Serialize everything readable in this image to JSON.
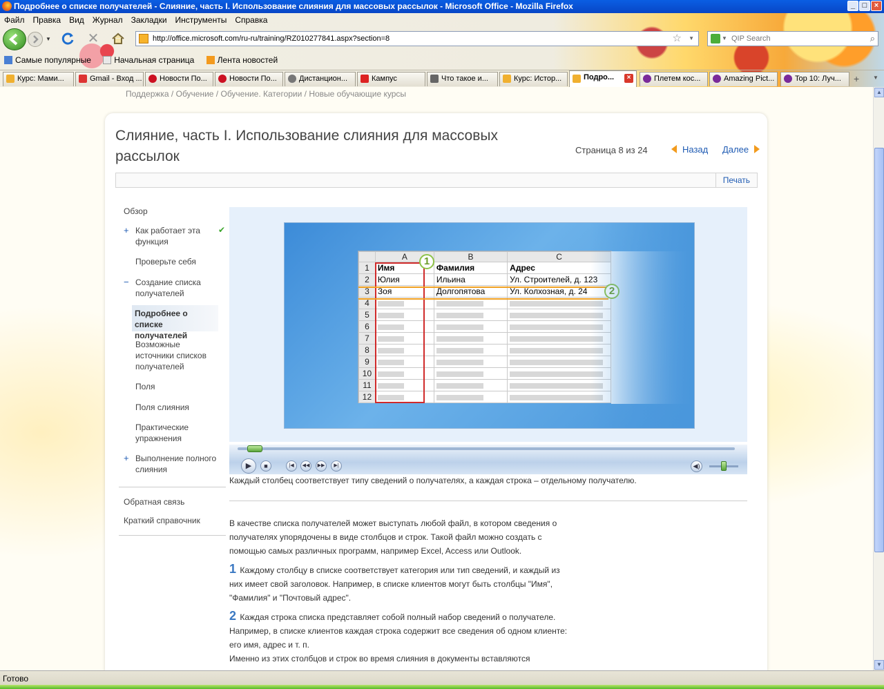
{
  "window": {
    "title": "Подробнее о списке получателей - Слияние, часть I. Использование слияния для массовых рассылок - Microsoft Office - Mozilla Firefox"
  },
  "menu": [
    "Файл",
    "Правка",
    "Вид",
    "Журнал",
    "Закладки",
    "Инструменты",
    "Справка"
  ],
  "address": {
    "url": "http://office.microsoft.com/ru-ru/training/RZ010277841.aspx?section=8"
  },
  "search": {
    "placeholder": "QIP Search"
  },
  "bookmarks": [
    "Самые популярные",
    "Начальная страница",
    "Лента новостей"
  ],
  "tabs": [
    {
      "label": "Курс: Мами...",
      "color": "#f0b030"
    },
    {
      "label": "Gmail - Вход ...",
      "color": "#d33"
    },
    {
      "label": "Новости По...",
      "color": "#c12"
    },
    {
      "label": "Новости По...",
      "color": "#c12"
    },
    {
      "label": "Дистанцион...",
      "color": "#777"
    },
    {
      "label": "Кампус",
      "color": "#d22"
    },
    {
      "label": "Что такое и...",
      "color": "#666"
    },
    {
      "label": "Курс: Истор...",
      "color": "#f0b030"
    },
    {
      "label": "Подро...",
      "color": "#f0b030"
    },
    {
      "label": "Плетем кос...",
      "color": "#7a2a9a"
    },
    {
      "label": "Amazing Pict...",
      "color": "#7a2a9a"
    },
    {
      "label": "Top 10: Луч...",
      "color": "#7a2a9a"
    }
  ],
  "page": {
    "breadcrumbs": "Поддержка / Обучение / Обучение. Категории / Новые обучающие курсы",
    "title": "Слияние, часть I. Использование слияния для массовых рассылок",
    "page_count": "Страница 8 из 24",
    "back": "Назад",
    "next": "Далее",
    "print": "Печать"
  },
  "nav": {
    "overview": "Обзор",
    "items": [
      "Как работает эта функция",
      "Проверьте себя",
      "Создание списка получателей",
      "Подробнее о списке получателей",
      "Возможные источники списков получателей",
      "Поля",
      "Поля слияния",
      "Практические упражнения",
      "Выполнение полного слияния"
    ],
    "feedback": "Обратная связь",
    "quickref": "Краткий справочник"
  },
  "sheet": {
    "col_headers": [
      "A",
      "B",
      "C"
    ],
    "rows": [
      [
        "Имя",
        "Фамилия",
        "Адрес"
      ],
      [
        "Юлия",
        "Ильина",
        "Ул. Строителей, д. 123"
      ],
      [
        "Зоя",
        "Долгопятова",
        "Ул. Колхозная, д. 24"
      ]
    ],
    "row_numbers": [
      "1",
      "2",
      "3",
      "4",
      "5",
      "6",
      "7",
      "8",
      "9",
      "10",
      "11",
      "12"
    ],
    "callouts": [
      "1",
      "2"
    ]
  },
  "media": {
    "caption": "Каждый столбец соответствует типу сведений о получателях, а каждая строка – отдельному получателю.",
    "progress": 0.02,
    "volume": 0.5
  },
  "body": {
    "intro": "В качестве списка получателей может выступать любой файл, в котором сведения о получателях упорядочены в виде столбцов и строк. Такой файл можно создать с помощью самых различных программ, например Excel, Access или Outlook.",
    "p1_num": "1",
    "p1": "Каждому столбцу в списке соответствует категория или тип сведений, и каждый из них имеет свой заголовок. Например, в списке клиентов могут быть столбцы \"Имя\", \"Фамилия\" и \"Почтовый адрес\".",
    "p2_num": "2",
    "p2": "Каждая строка списка представляет собой полный набор сведений о получателе. Например, в списке клиентов каждая строка содержит все сведения об одном клиенте: его имя, адрес и т. п.",
    "p3": "Именно из этих столбцов и строк во время слияния в документы вставляются уникальные сведения о получателях."
  },
  "status": {
    "text": "Готово"
  }
}
